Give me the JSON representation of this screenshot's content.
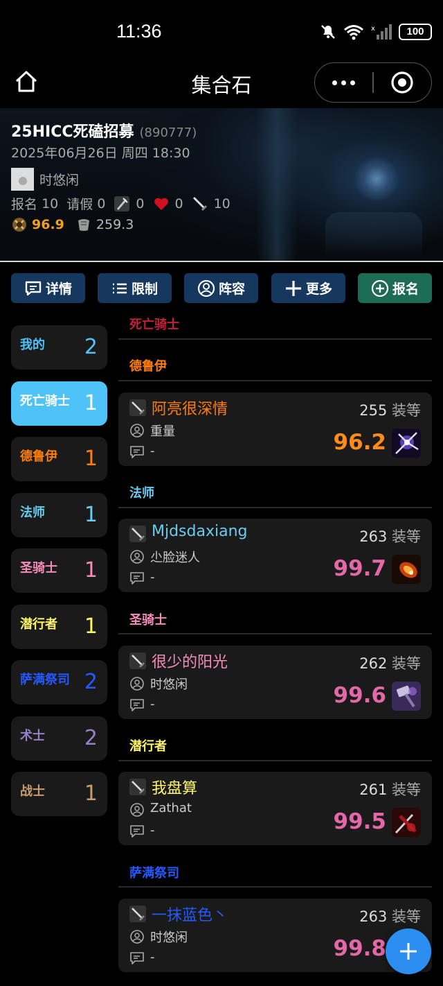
{
  "status": {
    "time": "11:36",
    "battery": "100"
  },
  "nav": {
    "title": "集合石"
  },
  "event": {
    "title": "25HICC死磕招募",
    "id": "(890777)",
    "datetime": "2025年06月26日 周四 18:30",
    "leader": "时悠闲",
    "signup_label": "报名",
    "signup_count": "10",
    "leave_label": "请假",
    "leave_count": "0",
    "tank_count": "0",
    "healer_count": "0",
    "dps_count": "10",
    "avg_score": "96.9",
    "avg_ilvl": "259.3",
    "colors": {
      "score": "#f0a020"
    }
  },
  "actions": [
    {
      "label": "详情",
      "icon": "chat-bubble-icon"
    },
    {
      "label": "限制",
      "icon": "list-icon"
    },
    {
      "label": "阵容",
      "icon": "user-circle-icon"
    },
    {
      "label": "更多",
      "icon": "plus-icon"
    },
    {
      "label": "报名",
      "icon": "plus-circle-icon"
    }
  ],
  "sidebar": [
    {
      "label": "我的",
      "count": "2",
      "color": "#4fc3f7"
    },
    {
      "label": "死亡骑士",
      "count": "1",
      "color": "#ffffff"
    },
    {
      "label": "德鲁伊",
      "count": "1",
      "color": "#ff7d0a"
    },
    {
      "label": "法师",
      "count": "1",
      "color": "#69ccf0"
    },
    {
      "label": "圣骑士",
      "count": "1",
      "color": "#f58cba"
    },
    {
      "label": "潜行者",
      "count": "1",
      "color": "#fff569"
    },
    {
      "label": "萨满祭司",
      "count": "2",
      "color": "#2459ff"
    },
    {
      "label": "术士",
      "count": "2",
      "color": "#9482c9"
    },
    {
      "label": "战士",
      "count": "1",
      "color": "#c79c6e"
    }
  ],
  "sections": [
    {
      "title": "死亡骑士",
      "color": "#c41f3b"
    },
    {
      "title": "德鲁伊",
      "color": "#ff7d0a"
    },
    {
      "title": "法师",
      "color": "#69ccf0"
    },
    {
      "title": "圣骑士",
      "color": "#f58cba"
    },
    {
      "title": "潜行者",
      "color": "#fff569"
    },
    {
      "title": "萨满祭司",
      "color": "#2459ff"
    }
  ],
  "members": [
    {
      "name": "阿亮很深情",
      "ilvl": "255",
      "ilvl_unit": "装等",
      "spec": "重量",
      "note": "-",
      "score": "96.2",
      "name_color": "#ff7d0a",
      "score_color": "#ff8c1a",
      "spec_icon": "arcane-burst-icon"
    },
    {
      "name": "Mjdsdaxiang",
      "ilvl": "263",
      "ilvl_unit": "装等",
      "spec": "尐脸迷人",
      "note": "-",
      "score": "99.7",
      "name_color": "#69ccf0",
      "score_color": "#e268a8",
      "spec_icon": "fire-icon"
    },
    {
      "name": "很少的阳光",
      "ilvl": "262",
      "ilvl_unit": "装等",
      "spec": "时悠闲",
      "note": "-",
      "score": "99.6",
      "name_color": "#f58cba",
      "score_color": "#e268a8",
      "spec_icon": "hammer-icon"
    },
    {
      "name": "我盘算",
      "ilvl": "261",
      "ilvl_unit": "装等",
      "spec": "Zathat",
      "note": "-",
      "score": "99.5",
      "name_color": "#fff569",
      "score_color": "#e268a8",
      "spec_icon": "dagger-icon"
    },
    {
      "name": "一抹蓝色丶",
      "ilvl": "263",
      "ilvl_unit": "装等",
      "spec": "时悠闲",
      "note": "-",
      "score": "99.8",
      "name_color": "#2459ff",
      "score_color": "#e268a8",
      "spec_icon": "lightning-icon"
    }
  ]
}
